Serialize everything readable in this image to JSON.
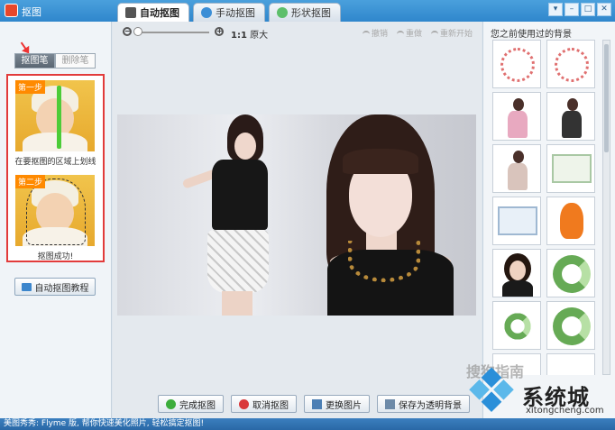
{
  "window": {
    "title": "抠图",
    "buttons": [
      "▾",
      "–",
      "□",
      "✕"
    ]
  },
  "tabs": [
    {
      "label": "自动抠图",
      "icon": "scissors-icon",
      "active": true
    },
    {
      "label": "手动抠图",
      "icon": "gear-icon",
      "active": false
    },
    {
      "label": "形状抠图",
      "icon": "shape-icon",
      "active": false
    }
  ],
  "left_panel": {
    "mode_brush": "抠图笔",
    "mode_eraser": "删除笔",
    "step1_tag": "第一步",
    "step1_caption": "在要抠图的区域上划线",
    "step2_tag": "第二步",
    "step2_caption": "抠图成功!",
    "tutorial_button": "自动抠图教程"
  },
  "toolbar": {
    "ratio_value": "1:1",
    "ratio_label": "原大",
    "undo": "撤销",
    "redo": "重做",
    "restart": "重新开始"
  },
  "bottom_buttons": {
    "finish": "完成抠图",
    "cancel": "取消抠图",
    "replace": "更换图片",
    "save": "保存为透明背景"
  },
  "right_panel": {
    "title": "您之前使用过的背景"
  },
  "watermark": {
    "gray_text": "搜狗指南",
    "brand": "系统城",
    "site": "xitongcheng.com"
  },
  "status": {
    "text": "美图秀秀: Flyme 版, 帮你快速美化照片, 轻松搞定抠图!"
  }
}
